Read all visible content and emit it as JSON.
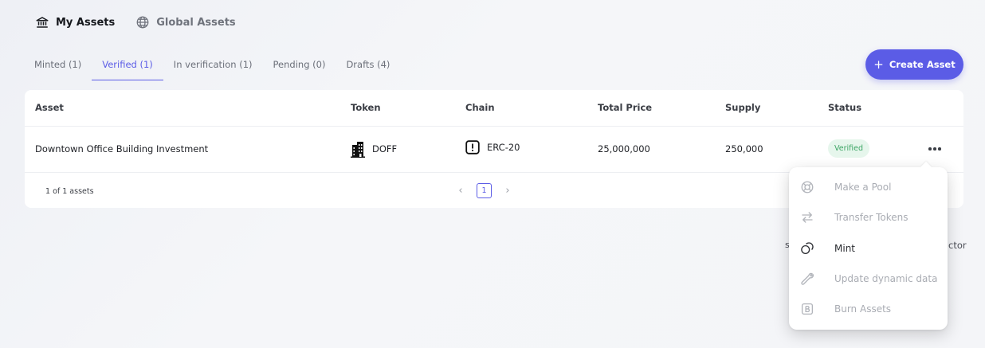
{
  "top_tabs": {
    "my_assets": "My Assets",
    "global_assets": "Global Assets"
  },
  "sub_tabs": [
    {
      "label": "Minted (1)"
    },
    {
      "label": "Verified (1)"
    },
    {
      "label": "In verification (1)"
    },
    {
      "label": "Pending (0)"
    },
    {
      "label": "Drafts (4)"
    }
  ],
  "active_sub_tab": "Verified (1)",
  "create_button": {
    "label": "Create Asset"
  },
  "table": {
    "headers": {
      "asset": "Asset",
      "token": "Token",
      "chain": "Chain",
      "total_price": "Total Price",
      "supply": "Supply",
      "status": "Status"
    },
    "rows": [
      {
        "asset": "Downtown Office Building Investment",
        "token": "DOFF",
        "chain": "ERC-20",
        "total_price": "25,000,000",
        "supply": "250,000",
        "status": "Verified"
      }
    ],
    "footer": {
      "count": "1 of 1 assets",
      "current_page": "1"
    }
  },
  "background_text": {
    "left": "s",
    "right": "ctor"
  },
  "action_menu": {
    "items": [
      {
        "label": "Make a Pool",
        "icon": "lifebuoy-icon",
        "enabled": false
      },
      {
        "label": "Transfer Tokens",
        "icon": "transfer-arrows-icon",
        "enabled": false
      },
      {
        "label": "Mint",
        "icon": "coins-icon",
        "enabled": true
      },
      {
        "label": "Update dynamic data",
        "icon": "wrench-icon",
        "enabled": false
      },
      {
        "label": "Burn Assets",
        "icon": "b-square-icon",
        "enabled": false
      }
    ]
  },
  "colors": {
    "accent": "#5b5ce6",
    "status_verified_bg": "#e6f6ec",
    "status_verified_text": "#3ca564",
    "disabled_text": "#a9acb3"
  }
}
